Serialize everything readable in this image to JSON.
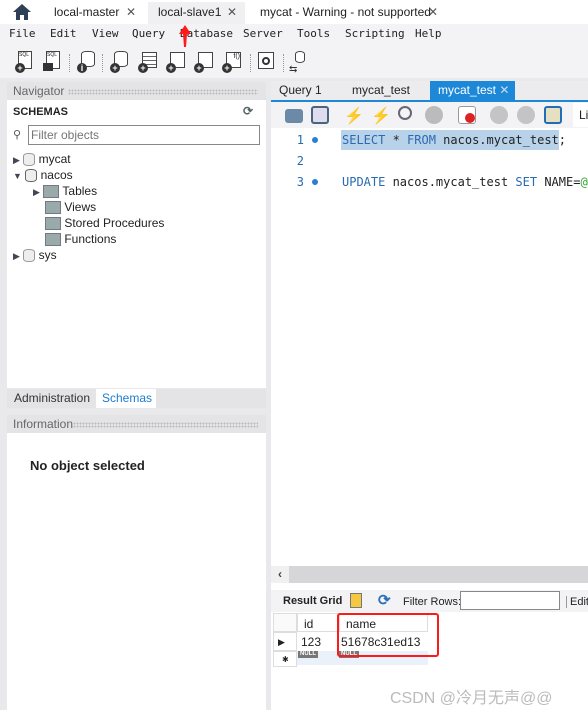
{
  "connection_tabs": [
    {
      "label": "local-master",
      "active": false
    },
    {
      "label": "local-slave1",
      "active": true
    },
    {
      "label": "mycat - Warning - not supported",
      "active": false
    }
  ],
  "menu": [
    "File",
    "Edit",
    "View",
    "Query",
    "Database",
    "Server",
    "Tools",
    "Scripting",
    "Help"
  ],
  "navigator": {
    "title": "Navigator",
    "schemas_label": "SCHEMAS",
    "filter_placeholder": "Filter objects",
    "schemas": [
      {
        "name": "mycat",
        "expanded": false
      },
      {
        "name": "nacos",
        "expanded": true,
        "children": [
          "Tables",
          "Views",
          "Stored Procedures",
          "Functions"
        ]
      },
      {
        "name": "sys",
        "expanded": false
      }
    ]
  },
  "bottom_tabs": [
    {
      "label": "Administration",
      "active": false
    },
    {
      "label": "Schemas",
      "active": true
    }
  ],
  "information": {
    "title": "Information",
    "message": "No object selected"
  },
  "query_tabs": [
    {
      "label": "Query 1"
    },
    {
      "label": "mycat_test"
    },
    {
      "label": "mycat_test",
      "active": true
    }
  ],
  "editor_toolbar": {
    "limit_label_partial": "Li"
  },
  "editor": {
    "lines": [
      {
        "num": "1",
        "kw1": "SELECT",
        "rest1": " * ",
        "kw2": "FROM",
        "rest2": " nacos.mycat_test;"
      },
      {
        "num": "2"
      },
      {
        "num": "3",
        "kw1": "UPDATE",
        "rest1": " nacos.mycat_test ",
        "kw2": "SET",
        "rest2": " NAME=",
        "tail": "@@"
      }
    ]
  },
  "result": {
    "result_grid_label": "Result Grid",
    "filter_label": "Filter Rows:",
    "filter_value": "",
    "edit_label_partial": "Edit:",
    "columns": [
      "id",
      "name"
    ],
    "rows": [
      [
        "123",
        "51678c31ed13"
      ]
    ],
    "null_label": "NULL"
  },
  "watermark": "CSDN @冷月无声@@",
  "colors": {
    "accent": "#1e88d8",
    "annotation": "#ff1a1a",
    "selection": "#b8d2ea"
  }
}
